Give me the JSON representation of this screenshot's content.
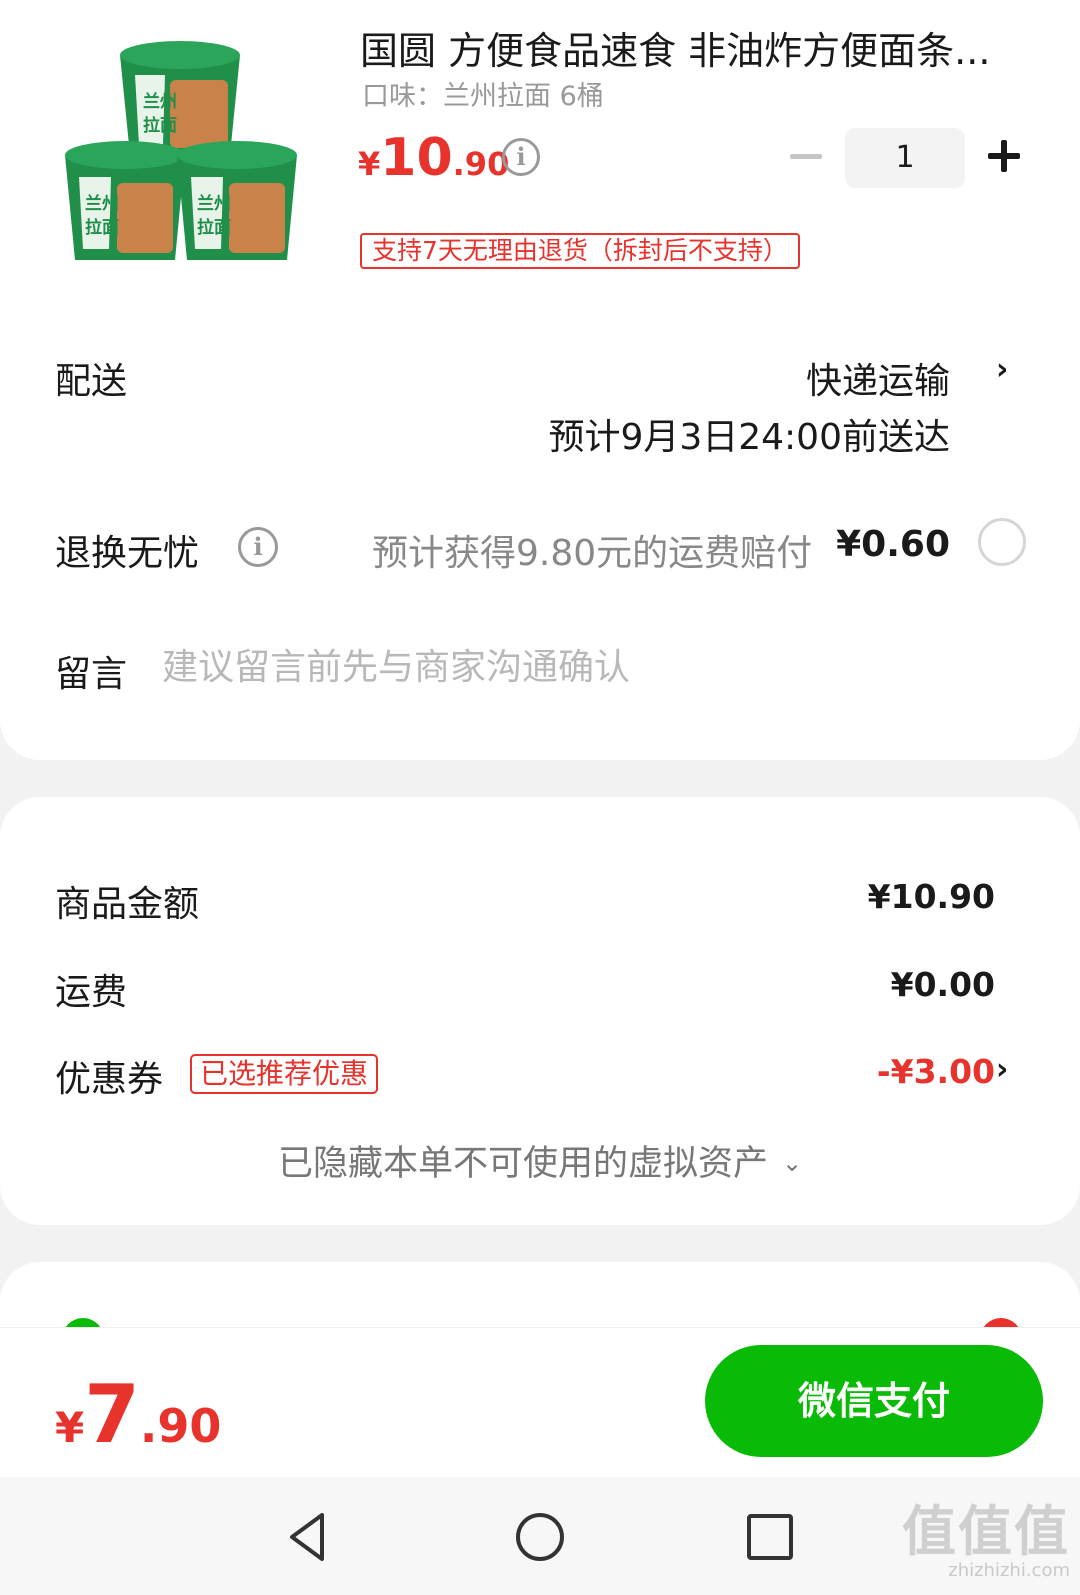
{
  "product": {
    "title": "国圆 方便食品速食 非油炸方便面条...",
    "spec": "口味：兰州拉面 6桶",
    "price_symbol": "¥",
    "price_int": "10",
    "price_dec": ".90",
    "info_glyph": "i",
    "quantity": "1",
    "return_policy": "支持7天无理由退货（拆封后不支持）",
    "package_text": "兰州拉面"
  },
  "delivery": {
    "label": "配送",
    "method": "快递运输",
    "eta": "预计9月3日24:00前送达",
    "chevron": "›"
  },
  "worry_free": {
    "label": "退换无忧",
    "info_glyph": "i",
    "description": "预计获得9.80元的运费赔付",
    "price": "¥0.60"
  },
  "message": {
    "label": "留言",
    "placeholder": "建议留言前先与商家沟通确认"
  },
  "summary": {
    "goods_label": "商品金额",
    "goods_value": "¥10.90",
    "shipping_label": "运费",
    "shipping_value": "¥0.00",
    "coupon_label": "优惠券",
    "coupon_tag": "已选推荐优惠",
    "coupon_value": "-¥3.00",
    "coupon_chevron": "›",
    "hidden_assets": "已隐藏本单不可使用的虚拟资产",
    "hidden_caret": "⌄"
  },
  "footer": {
    "total_symbol": "¥",
    "total_int": "7",
    "total_dec": ".90",
    "pay_label": "微信支付"
  },
  "watermark": {
    "glyph": "值值值",
    "url": "zhizhizhi.com"
  },
  "colors": {
    "accent_red": "#e8322c",
    "wechat_green": "#09bb07",
    "package_green": "#1f8f4a"
  }
}
